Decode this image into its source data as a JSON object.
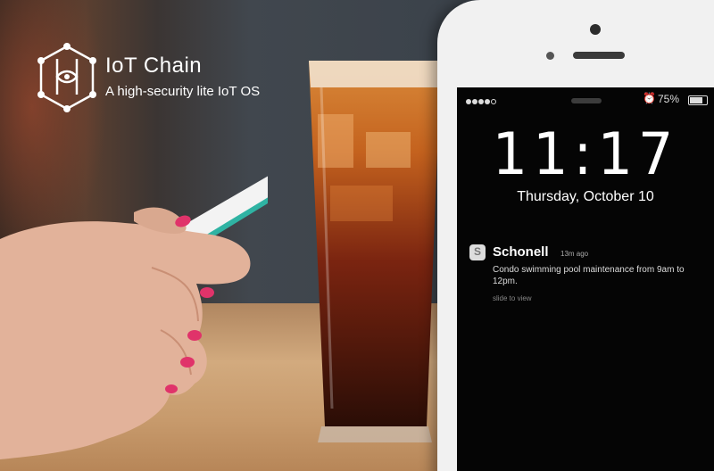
{
  "logo": {
    "brand": "IoT Chain",
    "tagline": "A high-security lite IoT OS"
  },
  "lockscreen": {
    "battery": "75%",
    "time": "11:17",
    "date": "Thursday, October 10"
  },
  "notification": {
    "app": "Schonell",
    "ago": "13m ago",
    "message": "Condo swimming pool maintenance from 9am to 12pm.",
    "slide_hint": "slide to view"
  },
  "icons": [
    "hexagon-logo-icon",
    "signal-dots-icon",
    "alarm-icon",
    "battery-icon",
    "schonell-app-icon"
  ]
}
